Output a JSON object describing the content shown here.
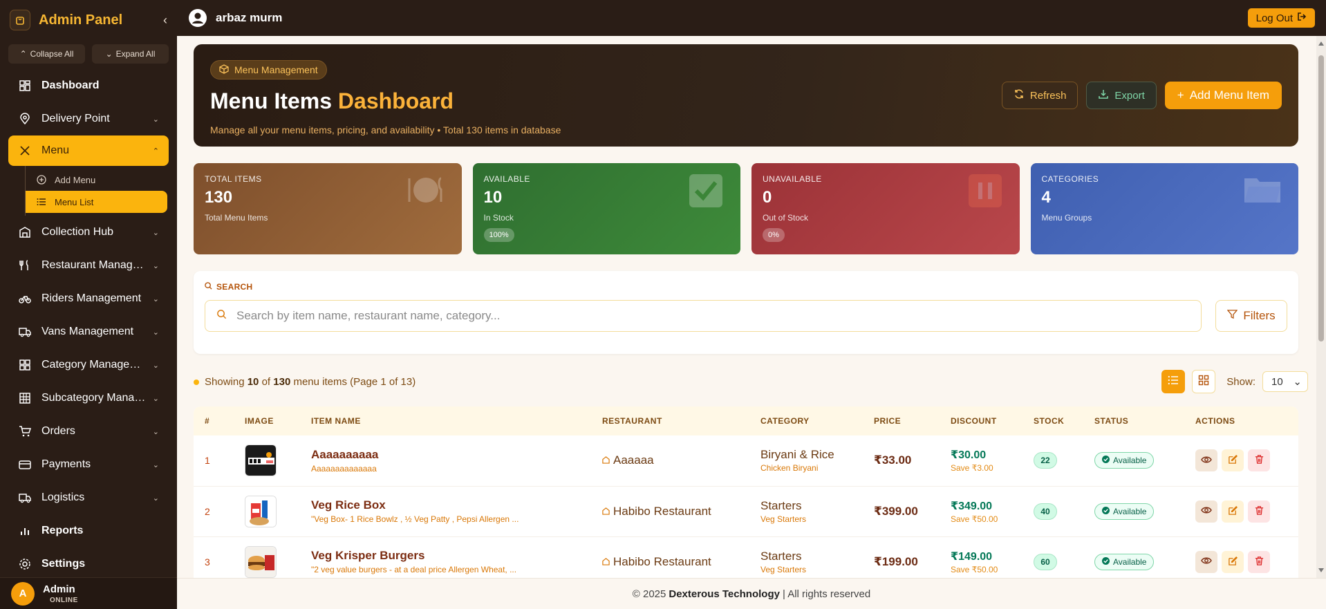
{
  "sidebar": {
    "title": "Admin Panel",
    "collapse_all": "Collapse All",
    "expand_all": "Expand All",
    "items": [
      {
        "label": "Dashboard"
      },
      {
        "label": "Delivery Point"
      },
      {
        "label": "Menu"
      },
      {
        "label": "Collection Hub"
      },
      {
        "label": "Restaurant Managem..."
      },
      {
        "label": "Riders Management"
      },
      {
        "label": "Vans Management"
      },
      {
        "label": "Category Management"
      },
      {
        "label": "Subcategory Manage..."
      },
      {
        "label": "Orders"
      },
      {
        "label": "Payments"
      },
      {
        "label": "Logistics"
      },
      {
        "label": "Reports"
      },
      {
        "label": "Settings"
      }
    ],
    "menu_sub": [
      {
        "label": "Add Menu"
      },
      {
        "label": "Menu List"
      }
    ],
    "footer": {
      "avatar_letter": "A",
      "name": "Admin",
      "status": "ONLINE"
    }
  },
  "topbar": {
    "user": "arbaz murm",
    "logout": "Log Out"
  },
  "hero": {
    "badge": "Menu Management",
    "title_main": "Menu Items",
    "title_accent": "Dashboard",
    "subtitle": "Manage all your menu items, pricing, and availability • Total 130 items in database",
    "refresh": "Refresh",
    "export": "Export",
    "add": "Add Menu Item"
  },
  "stats": [
    {
      "label": "TOTAL ITEMS",
      "value": "130",
      "desc": "Total Menu Items",
      "pct": ""
    },
    {
      "label": "AVAILABLE",
      "value": "10",
      "desc": "In Stock",
      "pct": "100%"
    },
    {
      "label": "UNAVAILABLE",
      "value": "0",
      "desc": "Out of Stock",
      "pct": "0%"
    },
    {
      "label": "CATEGORIES",
      "value": "4",
      "desc": "Menu Groups",
      "pct": ""
    }
  ],
  "search": {
    "label": "SEARCH",
    "placeholder": "Search by item name, restaurant name, category...",
    "filters": "Filters"
  },
  "listing": {
    "prefix": "Showing",
    "shown": "10",
    "of": "of",
    "total": "130",
    "suffix": "menu items (Page 1 of 13)",
    "show_label": "Show:",
    "page_size": "10"
  },
  "table": {
    "headers": [
      "#",
      "IMAGE",
      "ITEM NAME",
      "RESTAURANT",
      "CATEGORY",
      "PRICE",
      "DISCOUNT",
      "STOCK",
      "STATUS",
      "ACTIONS"
    ],
    "rows": [
      {
        "idx": "1",
        "name": "Aaaaaaaaaa",
        "desc": "Aaaaaaaaaaaaaa",
        "restaurant": "Aaaaaa",
        "category": "Biryani & Rice",
        "subcategory": "Chicken Biryani",
        "price": "₹33.00",
        "discount": "₹30.00",
        "save": "Save ₹3.00",
        "stock": "22",
        "status": "Available"
      },
      {
        "idx": "2",
        "name": "Veg Rice Box",
        "desc": "\"Veg Box- 1 Rice Bowlz , ½ Veg Patty , Pepsi Allergen ...",
        "restaurant": "Habibo Restaurant",
        "category": "Starters",
        "subcategory": "Veg Starters",
        "price": "₹399.00",
        "discount": "₹349.00",
        "save": "Save ₹50.00",
        "stock": "40",
        "status": "Available"
      },
      {
        "idx": "3",
        "name": "Veg Krisper Burgers",
        "desc": "\"2 veg value burgers - at a deal price Allergen Wheat, ...",
        "restaurant": "Habibo Restaurant",
        "category": "Starters",
        "subcategory": "Veg Starters",
        "price": "₹199.00",
        "discount": "₹149.00",
        "save": "Save ₹50.00",
        "stock": "60",
        "status": "Available"
      }
    ]
  },
  "footer": {
    "copy": "© 2025",
    "company": "Dexterous Technology",
    "rights": "| All rights reserved"
  }
}
